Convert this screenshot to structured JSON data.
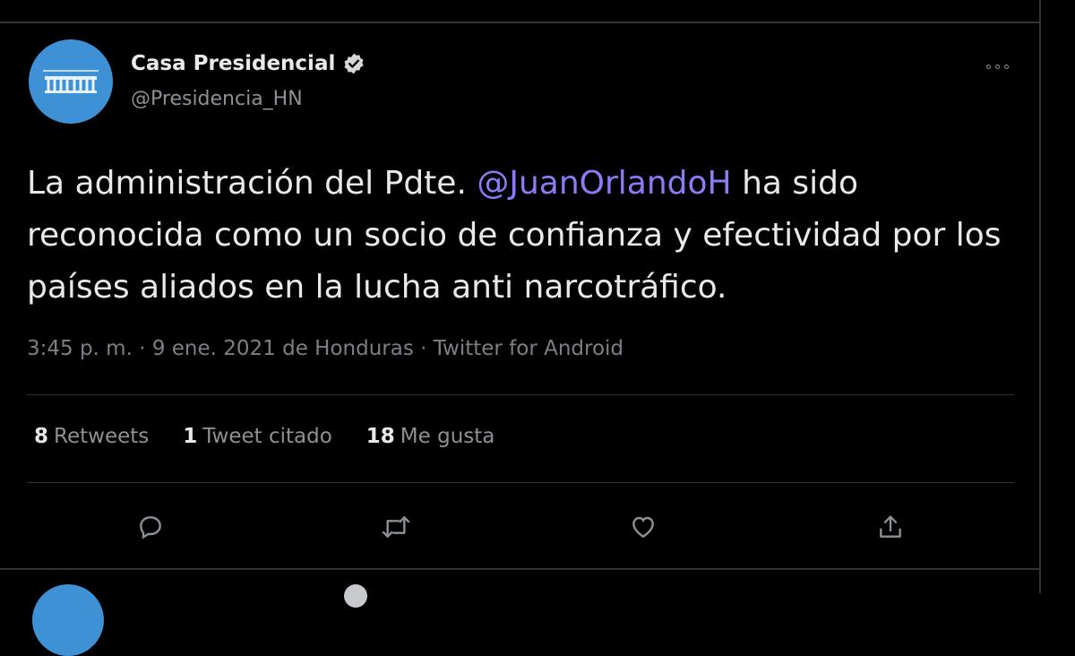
{
  "tweet": {
    "author_name": "Casa Presidencial",
    "author_handle": "@Presidencia_HN",
    "text_before": "La administración del Pdte. ",
    "mention": "@JuanOrlandoH",
    "text_after": " ha sido reconocida como un socio de confianza y efectividad por los países aliados en la lucha anti narcotráfico.",
    "meta": "3:45 p. m. · 9 ene. 2021 de Honduras · Twitter for Android",
    "stats": [
      {
        "count": "8",
        "label": "Retweets"
      },
      {
        "count": "1",
        "label": "Tweet citado"
      },
      {
        "count": "18",
        "label": "Me gusta"
      }
    ],
    "actions": [
      "reply-icon",
      "retweet-icon",
      "like-icon",
      "share-icon"
    ]
  },
  "colors": {
    "background": "#000000",
    "mention": "#8b7cf6",
    "avatar": "#3f91d6",
    "muted": "#8b9196"
  }
}
